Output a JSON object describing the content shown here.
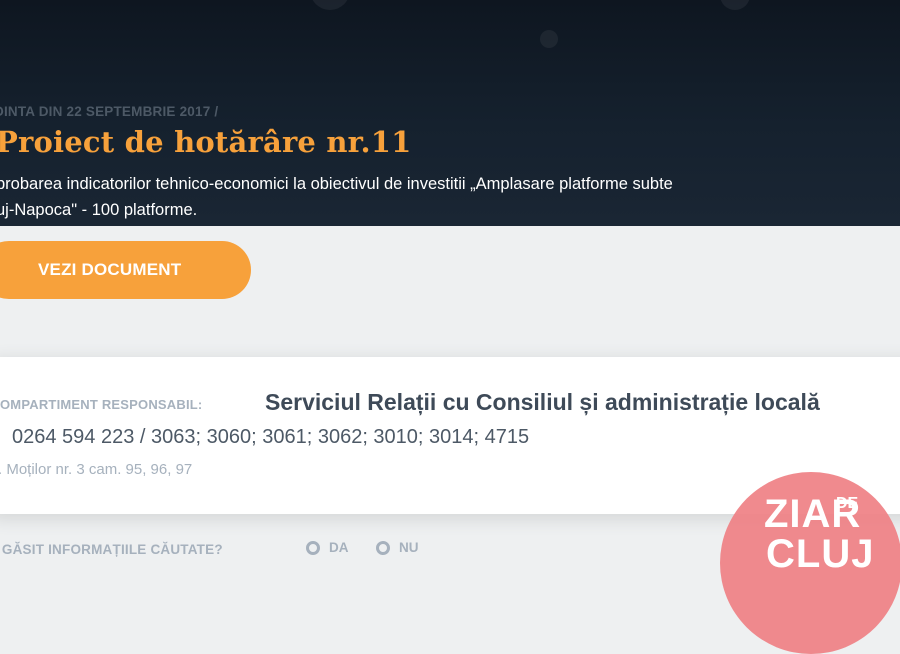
{
  "hero": {
    "breadcrumb": "DINTA DIN 22 SEPTEMBRIE 2017 /",
    "title": "Proiect de hotărâre nr.11",
    "description_line1": "probarea indicatorilor tehnico-economici la obiectivul de investitii „Amplasare platforme subte",
    "description_line2": "uj-Napoca\" - 100 platforme."
  },
  "actions": {
    "view_document_label": "VEZI DOCUMENT"
  },
  "responsible": {
    "label": "OMPARTIMENT RESPONSABIL:",
    "value": "Serviciul Relații cu Consiliul și administrație locală",
    "phone": "0264 594 223 / 3063; 3060; 3061; 3062; 3010; 3014; 4715",
    "address": ". Moților nr. 3 cam. 95, 96, 97"
  },
  "feedback": {
    "question": "I GĂSIT INFORMAȚIILE CĂUTATE?",
    "option_yes": "DA",
    "option_no": "NU"
  },
  "watermark": {
    "word1": "ZIAR",
    "word2": "CLUJ",
    "word3": "DE"
  },
  "colors": {
    "accent": "#f7a13b",
    "hero_bg": "#15212e",
    "muted_text": "#a6b1bd",
    "logo_pink": "#ef8084"
  }
}
